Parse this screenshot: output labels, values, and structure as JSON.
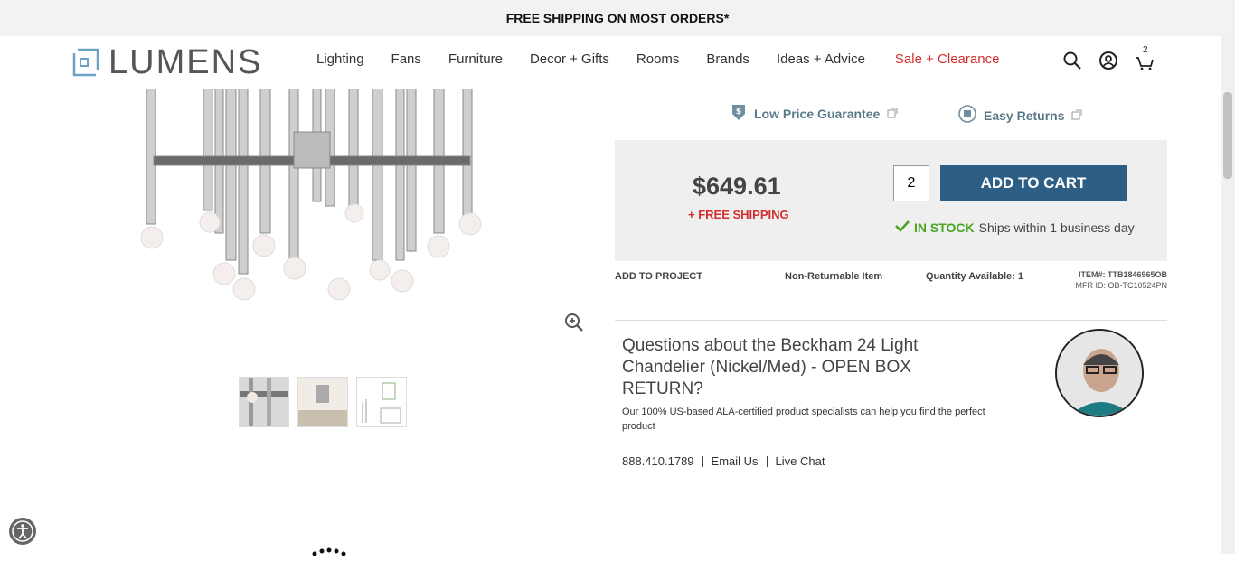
{
  "topbar": {
    "text": "FREE SHIPPING ON MOST ORDERS*"
  },
  "logo": {
    "text": "LUMENS"
  },
  "nav": {
    "items": [
      "Lighting",
      "Fans",
      "Furniture",
      "Decor + Gifts",
      "Rooms",
      "Brands",
      "Ideas + Advice"
    ],
    "sale": "Sale + Clearance"
  },
  "header_icons": {
    "cart_count": "2"
  },
  "guarantees": {
    "low_price": "Low Price Guarantee",
    "returns": "Easy Returns"
  },
  "buybox": {
    "price": "$649.61",
    "shipping": "+ FREE SHIPPING",
    "quantity": "2",
    "add_to_cart": "ADD TO CART",
    "stock_label": "IN STOCK",
    "stock_detail": "Ships within 1 business day"
  },
  "product_meta": {
    "add_to_project": "ADD TO PROJECT",
    "returnable": "Non-Returnable Item",
    "qty_available": "Quantity Available: 1",
    "item_id": "ITEM#: TTB1846965OB",
    "mfr_id": "MFR ID: OB-TC10524PN"
  },
  "questions": {
    "title": "Questions about the Beckham 24 Light Chandelier (Nickel/Med) - OPEN BOX RETURN?",
    "subtitle": "Our 100% US-based ALA-certified product specialists can help you find the perfect product",
    "phone": "888.410.1789",
    "email": "Email Us",
    "chat": "Live Chat"
  },
  "colors": {
    "accent": "#2d5f86",
    "sale": "#d32f2f",
    "stock": "#4aa524"
  }
}
